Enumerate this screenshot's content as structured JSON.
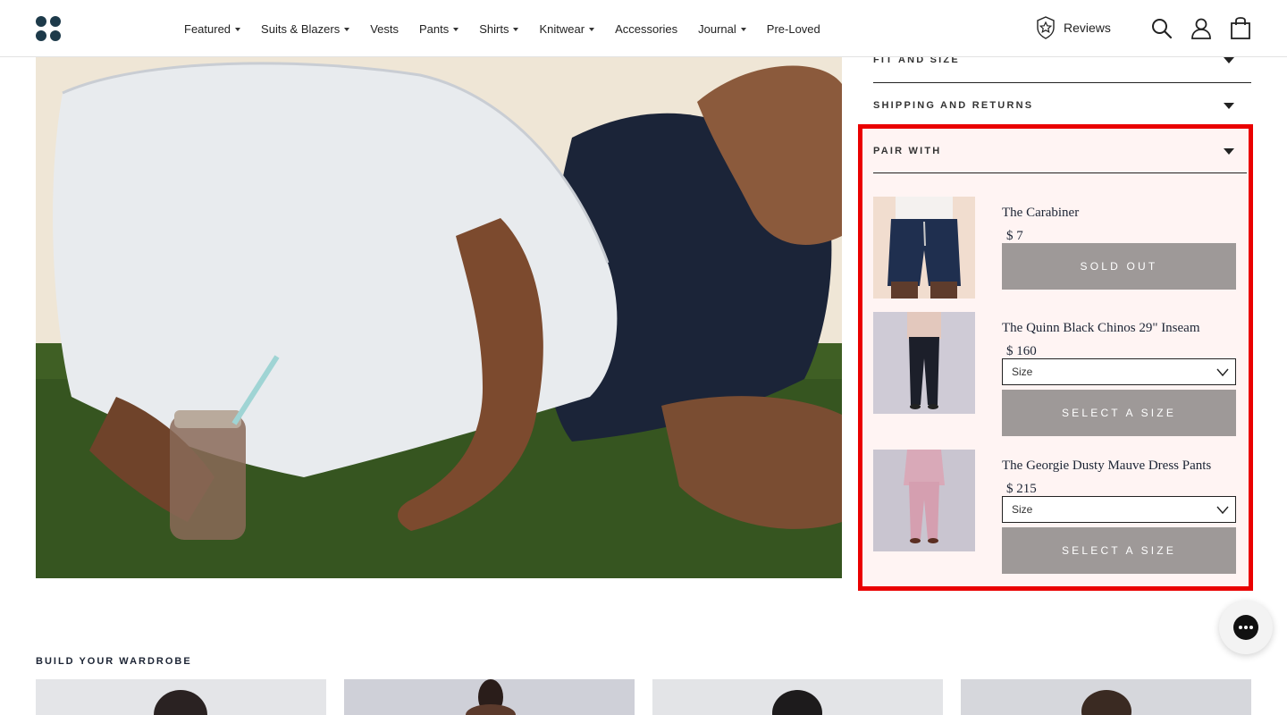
{
  "header": {
    "nav": [
      {
        "label": "Featured",
        "has_dropdown": true
      },
      {
        "label": "Suits & Blazers",
        "has_dropdown": true
      },
      {
        "label": "Vests",
        "has_dropdown": false
      },
      {
        "label": "Pants",
        "has_dropdown": true
      },
      {
        "label": "Shirts",
        "has_dropdown": true
      },
      {
        "label": "Knitwear",
        "has_dropdown": true
      },
      {
        "label": "Accessories",
        "has_dropdown": false
      },
      {
        "label": "Journal",
        "has_dropdown": true
      },
      {
        "label": "Pre-Loved",
        "has_dropdown": false
      }
    ],
    "reviews_label": "Reviews",
    "icons": [
      "logo-icon",
      "reviews-star-icon",
      "search-icon",
      "account-icon",
      "cart-icon"
    ]
  },
  "accordions": {
    "fit_and_size": "FIT AND SIZE",
    "shipping_and_returns": "SHIPPING AND RETURNS",
    "pair_with": "PAIR WITH"
  },
  "pair_with": {
    "products": [
      {
        "name": "The Carabiner",
        "price": "$ 7",
        "button": "SOLD OUT",
        "has_size_select": false
      },
      {
        "name": "The Quinn Black Chinos 29\" Inseam",
        "price": "$ 160",
        "size_placeholder": "Size",
        "button": "SELECT A SIZE",
        "has_size_select": true
      },
      {
        "name": "The Georgie Dusty Mauve Dress Pants",
        "price": "$ 215",
        "size_placeholder": "Size",
        "button": "SELECT A SIZE",
        "has_size_select": true
      }
    ]
  },
  "wardrobe": {
    "title": "BUILD YOUR WARDROBE"
  },
  "colors": {
    "highlight_border": "#ea0000",
    "panel_bg": "#fff4f3",
    "button_gray": "#9e9998",
    "navy": "#1c2434"
  }
}
